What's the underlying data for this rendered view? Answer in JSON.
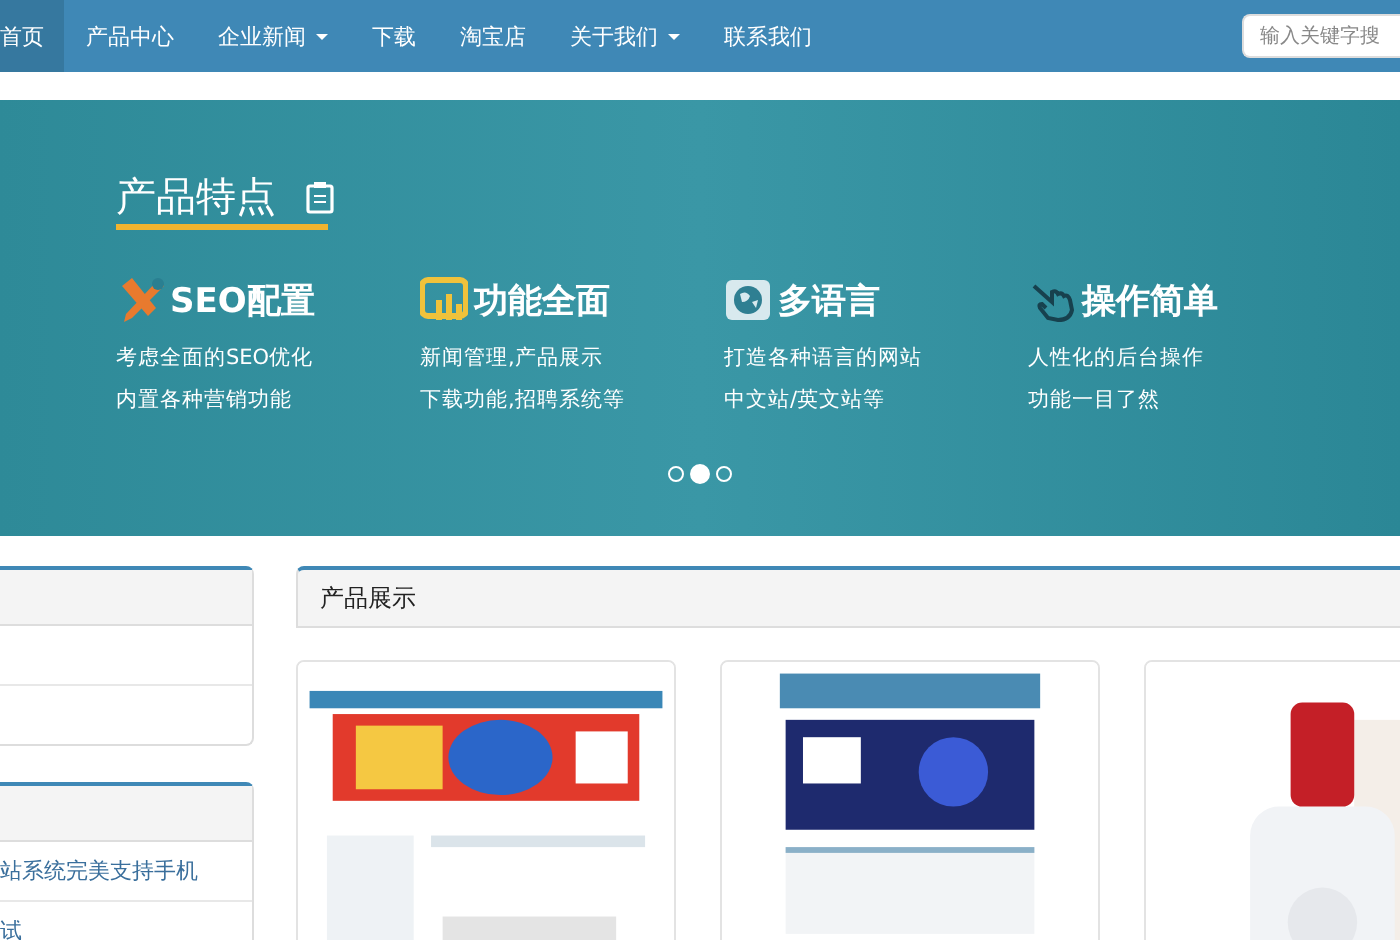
{
  "nav": {
    "items": [
      {
        "label": "首页",
        "selected": true,
        "dropdown": false
      },
      {
        "label": "产品中心",
        "selected": false,
        "dropdown": false
      },
      {
        "label": "企业新闻",
        "selected": false,
        "dropdown": true
      },
      {
        "label": "下载",
        "selected": false,
        "dropdown": false
      },
      {
        "label": "淘宝店",
        "selected": false,
        "dropdown": false
      },
      {
        "label": "关于我们",
        "selected": false,
        "dropdown": true
      },
      {
        "label": "联系我们",
        "selected": false,
        "dropdown": false
      }
    ],
    "search": {
      "placeholder": "输入关键字搜"
    }
  },
  "banner": {
    "title": "产品特点",
    "features": [
      {
        "kind": "tools",
        "title": "SEO配置",
        "lines": [
          "考虑全面的SEO优化",
          "内置各种营销功能"
        ]
      },
      {
        "kind": "chart",
        "title": "功能全面",
        "lines": [
          "新闻管理,产品展示",
          "下载功能,招聘系统等"
        ]
      },
      {
        "kind": "globe",
        "title": "多语言",
        "lines": [
          "打造各种语言的网站",
          "中文站/英文站等"
        ]
      },
      {
        "kind": "hand",
        "title": "操作简单",
        "lines": [
          "人性化的后台操作",
          "功能一目了然"
        ]
      }
    ],
    "dots": [
      {
        "selected": false
      },
      {
        "selected": true
      },
      {
        "selected": false
      }
    ]
  },
  "sidebar": {
    "panels": [
      {
        "items": [
          {
            "kind": "empty"
          },
          {
            "kind": "empty"
          }
        ]
      },
      {
        "items": [
          {
            "kind": "link",
            "label": "站系统完美支持手机"
          },
          {
            "kind": "link",
            "label": "试"
          }
        ]
      }
    ]
  },
  "products": {
    "title": "产品展示"
  }
}
